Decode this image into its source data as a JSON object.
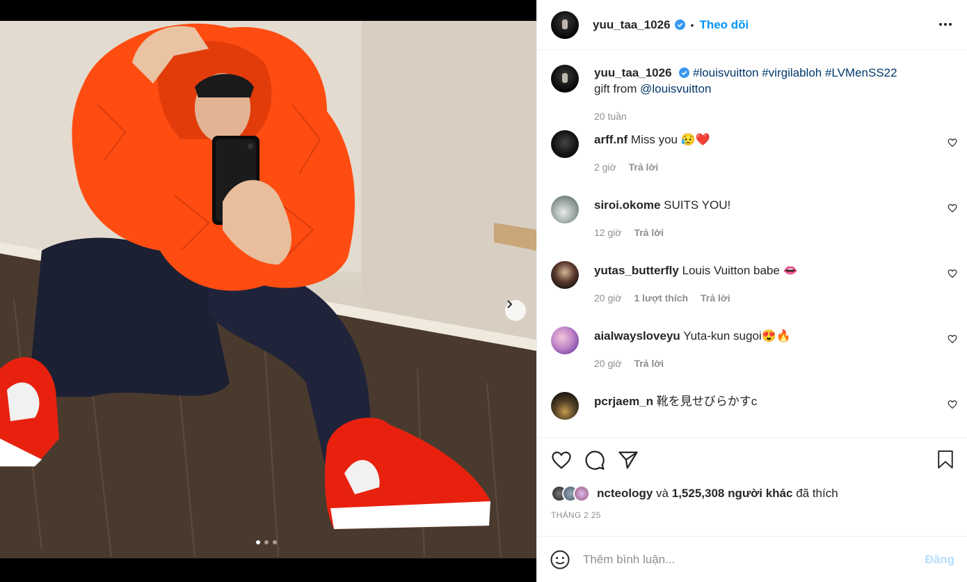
{
  "post": {
    "author": "yuu_taa_1026",
    "separator": "•",
    "follow_label": "Theo dõi",
    "caption": {
      "author": "yuu_taa_1026",
      "hashtags": "#louisvuitton #virgilabloh #LVMenSS22",
      "text": "gift from ",
      "mention": "@louisvuitton",
      "time": "20 tuần"
    },
    "comments": [
      {
        "user": "arff.nf",
        "text": "Miss you 😥❤️",
        "time": "2 giờ",
        "likes": "",
        "reply": "Trả lời"
      },
      {
        "user": "siroi.okome",
        "text": "SUITS YOU!",
        "time": "12 giờ",
        "likes": "",
        "reply": "Trả lời"
      },
      {
        "user": "yutas_butterfly",
        "text": "Louis Vuitton babe 👄",
        "time": "20 giờ",
        "likes": "1 lượt thích",
        "reply": "Trả lời"
      },
      {
        "user": "aialwaysloveyu",
        "text": "Yuta-kun sugoi😍🔥",
        "time": "20 giờ",
        "likes": "",
        "reply": "Trả lời"
      },
      {
        "user": "pcrjaem_n",
        "text": "靴を見せびらかすc",
        "time": "",
        "likes": "",
        "reply": ""
      }
    ],
    "likes": {
      "user": "nct eology",
      "user_display": "ncteology",
      "and": "và",
      "count": "1,525,308 người khác",
      "suffix": "đã thích"
    },
    "date": "THÁNG 2 25",
    "comment_input": {
      "placeholder": "Thêm bình luận..."
    },
    "post_button": "Đăng",
    "carousel": {
      "total": 3,
      "active": 1
    },
    "colors": {
      "accent": "#0095f6",
      "post_disabled": "#b2dffc",
      "like_red": "#ed4956"
    }
  }
}
